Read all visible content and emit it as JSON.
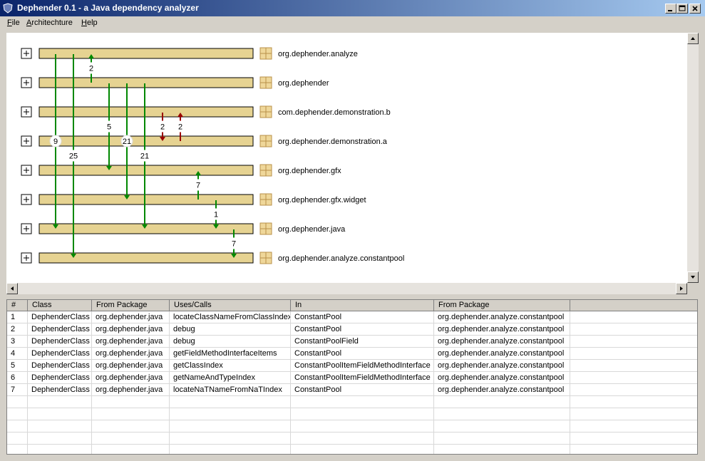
{
  "window": {
    "title": "Dephender 0.1 - a Java dependency analyzer"
  },
  "menu": {
    "items": [
      "File",
      "Architechture",
      "Help"
    ]
  },
  "packages": [
    {
      "name": "org.dephender.analyze"
    },
    {
      "name": "org.dephender"
    },
    {
      "name": "com.dephender.demonstration.b"
    },
    {
      "name": "org.dephender.demonstration.a"
    },
    {
      "name": "org.dephender.gfx"
    },
    {
      "name": "org.dephender.gfx.widget"
    },
    {
      "name": "org.dephender.java"
    },
    {
      "name": "org.dephender.analyze.constantpool"
    }
  ],
  "dependencies": [
    {
      "from": 0,
      "to": 6,
      "count": "9",
      "color": "#008800",
      "circle": true
    },
    {
      "from": 0,
      "to": 7,
      "count": "25",
      "color": "#008800",
      "circle": false
    },
    {
      "from": 1,
      "to": 0,
      "count": "2",
      "color": "#008800",
      "circle": false
    },
    {
      "from": 1,
      "to": 4,
      "count": "5",
      "color": "#008800",
      "circle": false
    },
    {
      "from": 1,
      "to": 5,
      "count": "21",
      "color": "#008800",
      "circle": true
    },
    {
      "from": 1,
      "to": 6,
      "count": "21",
      "color": "#008800",
      "circle": false
    },
    {
      "from": 2,
      "to": 3,
      "count": "2",
      "color": "#990000",
      "circle": false
    },
    {
      "from": 3,
      "to": 2,
      "count": "2",
      "color": "#990000",
      "circle": false
    },
    {
      "from": 5,
      "to": 4,
      "count": "7",
      "color": "#008800",
      "circle": false
    },
    {
      "from": 5,
      "to": 6,
      "count": "1",
      "color": "#008800",
      "circle": false
    },
    {
      "from": 6,
      "to": 7,
      "count": "7",
      "color": "#008800",
      "circle": false
    }
  ],
  "table": {
    "columns": [
      "#",
      "Class",
      "From Package",
      "Uses/Calls",
      "In",
      "From Package"
    ],
    "rows": [
      [
        "1",
        "DephenderClass",
        "org.dephender.java",
        "locateClassNameFromClassIndex",
        "ConstantPool",
        "org.dephender.analyze.constantpool"
      ],
      [
        "2",
        "DephenderClass",
        "org.dephender.java",
        "debug",
        "ConstantPool",
        "org.dephender.analyze.constantpool"
      ],
      [
        "3",
        "DephenderClass",
        "org.dephender.java",
        "debug",
        "ConstantPoolField",
        "org.dephender.analyze.constantpool"
      ],
      [
        "4",
        "DephenderClass",
        "org.dephender.java",
        "getFieldMethodInterfaceItems",
        "ConstantPool",
        "org.dephender.analyze.constantpool"
      ],
      [
        "5",
        "DephenderClass",
        "org.dephender.java",
        "getClassIndex",
        "ConstantPoolItemFieldMethodInterface",
        "org.dephender.analyze.constantpool"
      ],
      [
        "6",
        "DephenderClass",
        "org.dephender.java",
        "getNameAndTypeIndex",
        "ConstantPoolItemFieldMethodInterface",
        "org.dephender.analyze.constantpool"
      ],
      [
        "7",
        "DephenderClass",
        "org.dephender.java",
        "locateNaTNameFromNaTIndex",
        "ConstantPool",
        "org.dephender.analyze.constantpool"
      ]
    ]
  }
}
